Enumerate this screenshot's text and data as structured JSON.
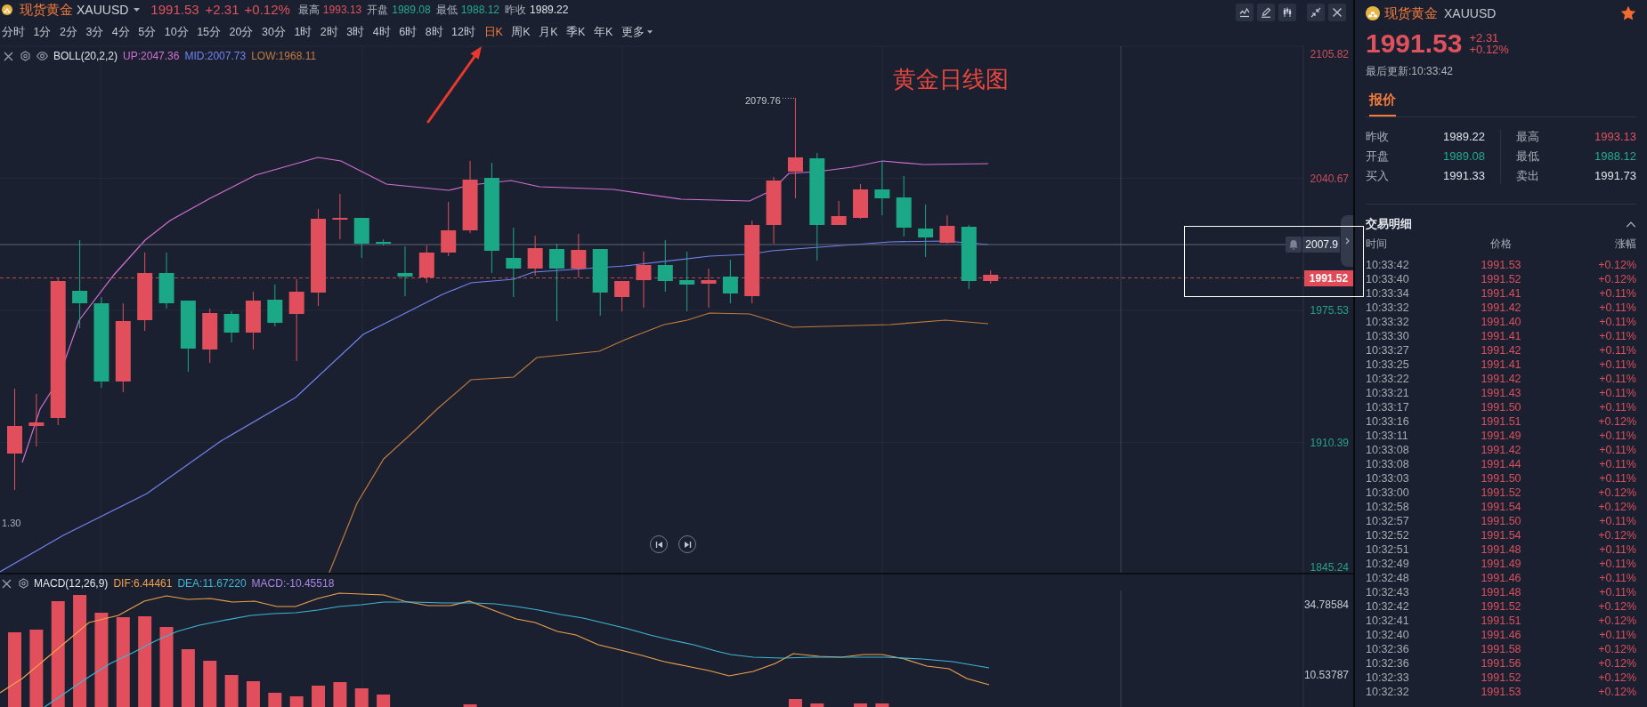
{
  "header": {
    "symbol_name": "现货黄金",
    "symbol_code": "XAUUSD",
    "rising": true,
    "price": "1991.53",
    "change": "+2.31",
    "change_percent": "+0.12%",
    "stats": [
      {
        "label": "最高",
        "value": "1993.13",
        "color": "#df515c"
      },
      {
        "label": "开盘",
        "value": "1989.08",
        "color": "#22ab8d"
      },
      {
        "label": "最低",
        "value": "1988.12",
        "color": "#22ab8d"
      },
      {
        "label": "昨收",
        "value": "1989.22",
        "color": "#dfe2e8"
      }
    ]
  },
  "timeframes": [
    {
      "label": "分时",
      "selected": false
    },
    {
      "label": "1分",
      "selected": false
    },
    {
      "label": "2分",
      "selected": false
    },
    {
      "label": "3分",
      "selected": false
    },
    {
      "label": "4分",
      "selected": false
    },
    {
      "label": "5分",
      "selected": false
    },
    {
      "label": "10分",
      "selected": false
    },
    {
      "label": "15分",
      "selected": false
    },
    {
      "label": "20分",
      "selected": false
    },
    {
      "label": "30分",
      "selected": false
    },
    {
      "label": "1时",
      "selected": false
    },
    {
      "label": "2时",
      "selected": false
    },
    {
      "label": "3时",
      "selected": false
    },
    {
      "label": "4时",
      "selected": false
    },
    {
      "label": "6时",
      "selected": false
    },
    {
      "label": "8时",
      "selected": false
    },
    {
      "label": "12时",
      "selected": false
    },
    {
      "label": "日K",
      "selected": true
    },
    {
      "label": "周K",
      "selected": false
    },
    {
      "label": "月K",
      "selected": false
    },
    {
      "label": "季K",
      "selected": false
    },
    {
      "label": "年K",
      "selected": false
    }
  ],
  "more_menu": {
    "label": "更多"
  },
  "main_chart": {
    "indicator": {
      "name": "BOLL(20,2,2)",
      "values": [
        {
          "text": "UP:2047.36",
          "color": "#d36fd3"
        },
        {
          "text": "MID:2007.73",
          "color": "#7283ee"
        },
        {
          "text": "LOW:1968.11",
          "color": "#c17a3e"
        }
      ]
    },
    "price_labels": [
      {
        "text": "2105.82",
        "color": "#c94f5a"
      },
      {
        "text": "2040.67",
        "color": "#c94f5a"
      },
      {
        "text": "1975.53",
        "color": "#26a08a"
      },
      {
        "text": "1910.39",
        "color": "#26a08a"
      },
      {
        "text": "1845.24",
        "color": "#26a08a"
      }
    ],
    "alert_label": "2007.9",
    "current_price_label": "1991.52",
    "high_label": "2079.76",
    "edge_label": "1.30"
  },
  "macd_chart": {
    "indicator": {
      "name": "MACD(12,26,9)",
      "values": [
        {
          "text": "DIF:6.44461",
          "color": "#f0a24e"
        },
        {
          "text": "DEA:11.67220",
          "color": "#3fb6d3"
        },
        {
          "text": "MACD:-10.45518",
          "color": "#a886e6"
        }
      ]
    },
    "axis_labels": [
      "34.78584",
      "10.53787"
    ]
  },
  "annotation": {
    "text": "黄金日线图"
  },
  "side_panel": {
    "symbol_name": "现货黄金",
    "symbol_code": "XAUUSD",
    "favorite": true,
    "rising": true,
    "price": "1991.53",
    "change": "+2.31",
    "change_percent": "+0.12%",
    "updated": "最后更新:10:33:42",
    "tabs": [
      {
        "label": "报价",
        "selected": true
      }
    ],
    "quote": [
      {
        "items": [
          {
            "label": "昨收",
            "value": "1989.22",
            "color": "#dfe2e8"
          },
          {
            "label": "开盘",
            "value": "1989.08",
            "color": "#22ab8d"
          },
          {
            "label": "买入",
            "value": "1991.33",
            "color": "#dfe2e8"
          }
        ]
      },
      {
        "items": [
          {
            "label": "最高",
            "value": "1993.13",
            "color": "#df515c"
          },
          {
            "label": "最低",
            "value": "1988.12",
            "color": "#22ab8d"
          },
          {
            "label": "卖出",
            "value": "1991.73",
            "color": "#dfe2e8"
          }
        ]
      }
    ],
    "trades": {
      "title": "交易明细",
      "expanded": true,
      "columns": [
        "时间",
        "价格",
        "涨幅"
      ],
      "rows": [
        {
          "time": "10:33:42",
          "price": "1991.53",
          "change": "+0.12%"
        },
        {
          "time": "10:33:40",
          "price": "1991.52",
          "change": "+0.12%"
        },
        {
          "time": "10:33:34",
          "price": "1991.41",
          "change": "+0.11%"
        },
        {
          "time": "10:33:32",
          "price": "1991.42",
          "change": "+0.11%"
        },
        {
          "time": "10:33:32",
          "price": "1991.40",
          "change": "+0.11%"
        },
        {
          "time": "10:33:30",
          "price": "1991.41",
          "change": "+0.11%"
        },
        {
          "time": "10:33:27",
          "price": "1991.42",
          "change": "+0.11%"
        },
        {
          "time": "10:33:25",
          "price": "1991.41",
          "change": "+0.11%"
        },
        {
          "time": "10:33:22",
          "price": "1991.42",
          "change": "+0.11%"
        },
        {
          "time": "10:33:21",
          "price": "1991.43",
          "change": "+0.11%"
        },
        {
          "time": "10:33:17",
          "price": "1991.50",
          "change": "+0.11%"
        },
        {
          "time": "10:33:16",
          "price": "1991.51",
          "change": "+0.12%"
        },
        {
          "time": "10:33:11",
          "price": "1991.49",
          "change": "+0.11%"
        },
        {
          "time": "10:33:08",
          "price": "1991.42",
          "change": "+0.11%"
        },
        {
          "time": "10:33:08",
          "price": "1991.44",
          "change": "+0.11%"
        },
        {
          "time": "10:33:03",
          "price": "1991.50",
          "change": "+0.11%"
        },
        {
          "time": "10:33:00",
          "price": "1991.52",
          "change": "+0.12%"
        },
        {
          "time": "10:32:58",
          "price": "1991.54",
          "change": "+0.12%"
        },
        {
          "time": "10:32:57",
          "price": "1991.50",
          "change": "+0.11%"
        },
        {
          "time": "10:32:52",
          "price": "1991.54",
          "change": "+0.12%"
        },
        {
          "time": "10:32:51",
          "price": "1991.48",
          "change": "+0.11%"
        },
        {
          "time": "10:32:49",
          "price": "1991.49",
          "change": "+0.11%"
        },
        {
          "time": "10:32:48",
          "price": "1991.46",
          "change": "+0.11%"
        },
        {
          "time": "10:32:43",
          "price": "1991.48",
          "change": "+0.11%"
        },
        {
          "time": "10:32:42",
          "price": "1991.52",
          "change": "+0.12%"
        },
        {
          "time": "10:32:41",
          "price": "1991.51",
          "change": "+0.12%"
        },
        {
          "time": "10:32:40",
          "price": "1991.46",
          "change": "+0.11%"
        },
        {
          "time": "10:32:36",
          "price": "1991.58",
          "change": "+0.12%"
        },
        {
          "time": "10:32:36",
          "price": "1991.56",
          "change": "+0.12%"
        },
        {
          "time": "10:32:33",
          "price": "1991.52",
          "change": "+0.12%"
        },
        {
          "time": "10:32:32",
          "price": "1991.53",
          "change": "+0.12%"
        }
      ]
    }
  }
}
